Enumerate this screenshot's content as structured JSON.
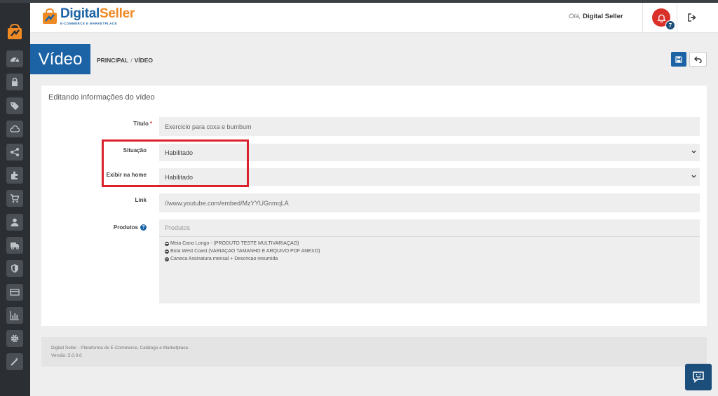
{
  "app": {
    "brand_main": "Digital",
    "brand_accent": "Seller",
    "brand_sub": "E-COMMERCE E MARKETPLACE",
    "colors": {
      "primary": "#1b63a5",
      "accent": "#f08a24",
      "danger": "#d9302a",
      "sidebar": "#2b2f33"
    }
  },
  "header": {
    "greeting_prefix": "Olá,",
    "user_name": "Digital Seller",
    "notifications_count": "7",
    "icons": [
      "bell-icon",
      "logout-icon"
    ]
  },
  "sidebar": {
    "items": [
      {
        "icon": "dashboard-icon"
      },
      {
        "icon": "lock-icon"
      },
      {
        "icon": "tags-icon"
      },
      {
        "icon": "cloud-icon"
      },
      {
        "icon": "share-icon"
      },
      {
        "icon": "puzzle-icon"
      },
      {
        "icon": "cart-icon"
      },
      {
        "icon": "user-icon"
      },
      {
        "icon": "truck-icon"
      },
      {
        "icon": "shield-icon"
      },
      {
        "icon": "credit-card-icon"
      },
      {
        "icon": "bar-chart-icon"
      },
      {
        "icon": "gear-icon"
      },
      {
        "icon": "magic-wand-icon"
      }
    ]
  },
  "page": {
    "title": "Vídeo",
    "breadcrumb": [
      "PRINCIPAL",
      "VÍDEO"
    ],
    "breadcrumb_sep": "/"
  },
  "form": {
    "heading": "Editando informações do vídeo",
    "titulo": {
      "label": "Título",
      "required_mark": "*",
      "value": "Exercicio para coxa e bumbum"
    },
    "situacao": {
      "label": "Situação",
      "value": "Habilitado"
    },
    "exibir_home": {
      "label": "Exibir na home",
      "value": "Habilitado"
    },
    "link": {
      "label": "Link",
      "value": "//www.youtube.com/embed/MzYYUGnmqLA"
    },
    "produtos": {
      "label": "Produtos",
      "help": "?",
      "placeholder": "Produtos",
      "items": [
        "Meia Cano Longo - (PRODUTO TESTE MULTIVARIAÇAO)",
        "Bota West Coast (VARIAÇAO TAMANHO E ARQUIVO PDF ANEXO)",
        "Caneca Assinatura mensal + Descricao resumida"
      ]
    }
  },
  "footer": {
    "line1": "Digital Seller - Plataforma de E-Commerce, Catálogo e Marketplace.",
    "line2": "Versão: 5.0.0.0"
  }
}
